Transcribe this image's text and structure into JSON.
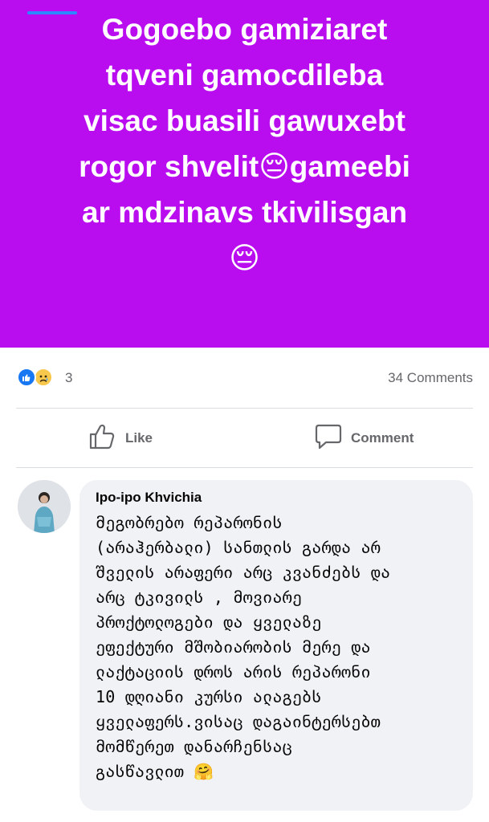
{
  "post": {
    "text": "Gogoebo gamiziaret\ntqveni gamocdileba\nvisac buasili gawuxebt\nrogor shvelit😔gameebi\nar mdzinavs tkivilisgan\n😔",
    "background_color": "#b90df0"
  },
  "reactions": {
    "icons": [
      "like-icon",
      "sad-icon"
    ],
    "count": "3",
    "comments_label": "34 Comments"
  },
  "actions": {
    "like_label": "Like",
    "comment_label": "Comment"
  },
  "comment": {
    "author": "Ipo-ipo Khvichia",
    "text": "მეგობრებო რეპარონის\n(არაჰერბალი) სანთლის გარდა არ\nშველის არაფერი არც კვანძებს და\nარც ტკივილს , მოვიარე\nპროქტოლოგები და ყველაზე\nეფექტური მშობიარობის მერე და\nლაქტაციის დროს არის რეპარონი\n10 დღიანი კურსი ალაგებს\nყველაფერს.ვისაც დაგაინტერსებთ\nმომწერეთ დანარჩენსაც\nგასწავლით 🤗"
  },
  "colors": {
    "accent": "#1877f2",
    "muted_text": "#65676b",
    "bubble": "#f0f2f5"
  }
}
